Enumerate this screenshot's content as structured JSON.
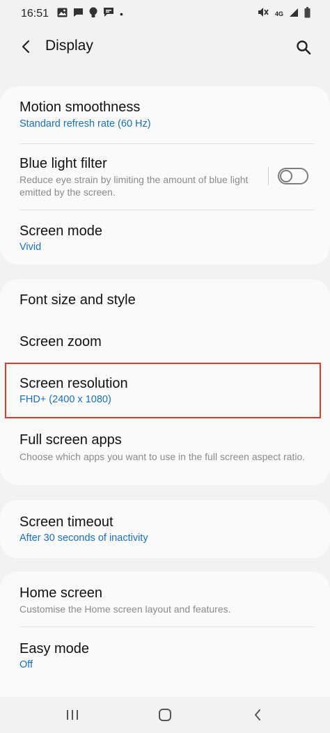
{
  "status": {
    "time": "16:51",
    "dot": "•",
    "network": "4G"
  },
  "app_bar": {
    "title": "Display"
  },
  "sections": {
    "motion": {
      "title": "Motion smoothness",
      "subtitle": "Standard refresh rate (60 Hz)"
    },
    "blue_light": {
      "title": "Blue light filter",
      "description": "Reduce eye strain by limiting the amount of blue light emitted by the screen.",
      "enabled": false
    },
    "screen_mode": {
      "title": "Screen mode",
      "subtitle": "Vivid"
    },
    "font": {
      "title": "Font size and style"
    },
    "zoom": {
      "title": "Screen zoom"
    },
    "resolution": {
      "title": "Screen resolution",
      "subtitle": "FHD+ (2400 x 1080)"
    },
    "full_screen": {
      "title": "Full screen apps",
      "description": "Choose which apps you want to use in the full screen aspect ratio."
    },
    "timeout": {
      "title": "Screen timeout",
      "subtitle": "After 30 seconds of inactivity"
    },
    "home": {
      "title": "Home screen",
      "description": "Customise the Home screen layout and features."
    },
    "easy": {
      "title": "Easy mode",
      "subtitle": "Off"
    }
  },
  "colors": {
    "accent": "#1a6fb8",
    "highlight": "#e23a2a",
    "background": "#f2f2f2",
    "card": "#fafafa"
  },
  "icons": [
    "image-icon",
    "message-icon",
    "bulb-icon",
    "chat-icon",
    "mute-icon",
    "signal-icon",
    "battery-icon",
    "back-icon",
    "search-icon",
    "recents-icon",
    "home-icon",
    "nav-back-icon"
  ]
}
